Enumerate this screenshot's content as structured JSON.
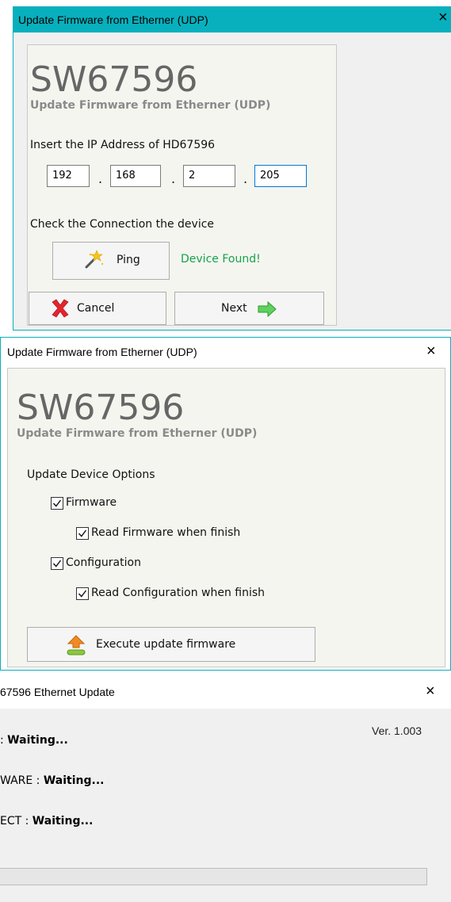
{
  "window1": {
    "title": "Update Firmware from Etherner (UDP)",
    "close_glyph": "×",
    "product": "SW67596",
    "subtitle": "Update Firmware from Etherner (UDP)",
    "ip_prompt": "Insert the IP Address of  HD67596",
    "ip": [
      "192",
      "168",
      "2",
      "205"
    ],
    "ip_separator": ".",
    "check_label": "Check the Connection the device",
    "ping_label": "Ping",
    "ping_icon": "magic-wand-icon",
    "status": "Device Found!",
    "cancel_label": "Cancel",
    "cancel_icon": "red-x-icon",
    "next_label": "Next",
    "next_icon": "green-arrow-icon",
    "status_color": "#16a34a",
    "title_color": "#08b0bd"
  },
  "window2": {
    "title": "Update Firmware from Etherner (UDP)",
    "close_glyph": "×",
    "product": "SW67596",
    "subtitle": "Update Firmware from Etherner (UDP)",
    "options_label": "Update Device Options",
    "options": [
      {
        "label": "Firmware",
        "checked": true
      },
      {
        "label": "Read Firmware when finish",
        "checked": true
      },
      {
        "label": "Configuration",
        "checked": true
      },
      {
        "label": "Read Configuration when finish",
        "checked": true
      }
    ],
    "execute_label": "Execute update firmware",
    "execute_icon": "upload-arrow-icon"
  },
  "window3": {
    "title": "67596 Ethernet Update",
    "close_glyph": "×",
    "version": "Ver. 1.003",
    "lines": [
      {
        "prefix": ": ",
        "value": "Waiting..."
      },
      {
        "prefix": "WARE :  ",
        "value": "Waiting..."
      },
      {
        "prefix": "ECT :  ",
        "value": "Waiting..."
      }
    ],
    "progress": 0
  }
}
